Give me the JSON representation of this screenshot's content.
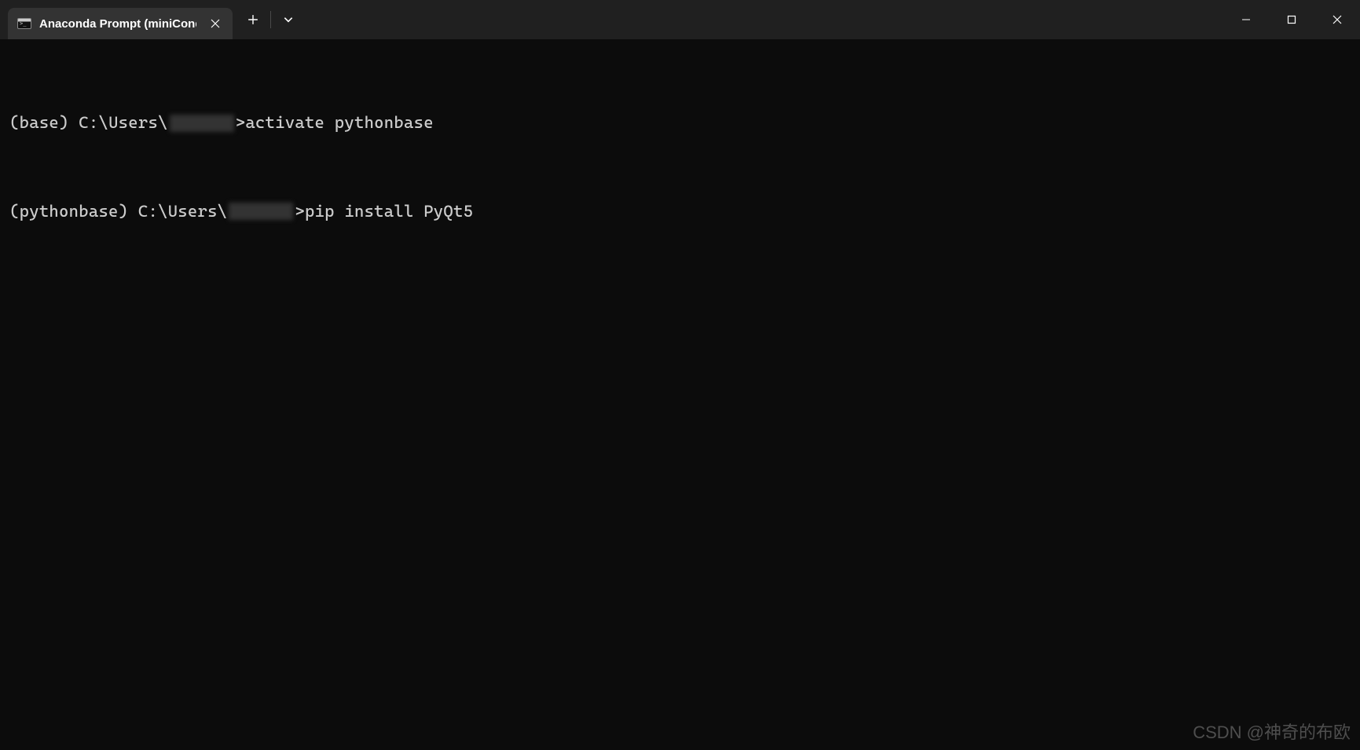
{
  "titlebar": {
    "tab_title": "Anaconda Prompt (miniConda",
    "tab_icon_name": "terminal-icon"
  },
  "terminal": {
    "lines": [
      {
        "env": "(base)",
        "path_prefix": "C:\\Users\\",
        "prompt_char": ">",
        "command": "activate pythonbase"
      },
      {
        "env": "(pythonbase)",
        "path_prefix": "C:\\Users\\",
        "prompt_char": ">",
        "command": "pip install PyQt5"
      }
    ]
  },
  "watermark": "CSDN @神奇的布欧"
}
